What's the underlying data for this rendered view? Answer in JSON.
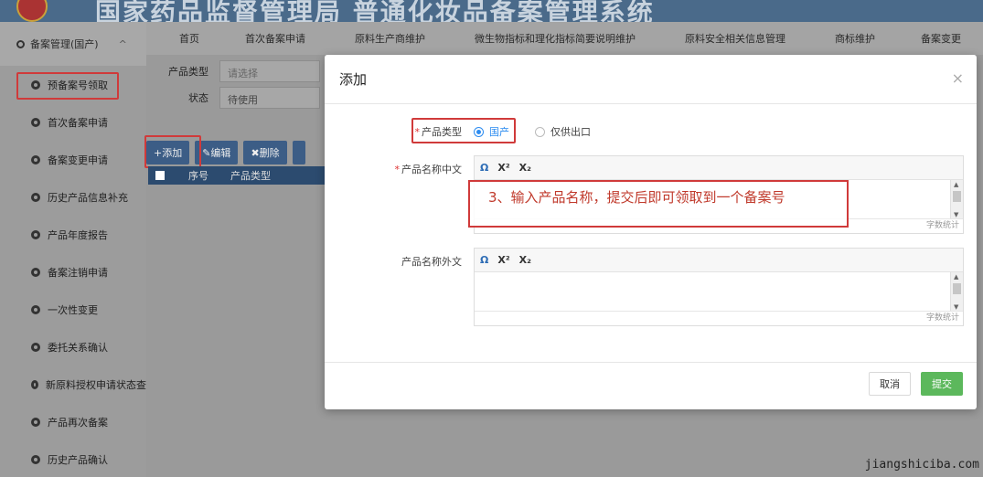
{
  "header": {
    "title": "国家药品监督管理局 普通化妆品备案管理系统"
  },
  "sidebar": {
    "group_label": "备案管理(国产)",
    "items": [
      {
        "label": "预备案号领取",
        "active": true
      },
      {
        "label": "首次备案申请"
      },
      {
        "label": "备案变更申请"
      },
      {
        "label": "历史产品信息补充"
      },
      {
        "label": "产品年度报告"
      },
      {
        "label": "备案注销申请"
      },
      {
        "label": "一次性变更"
      },
      {
        "label": "委托关系确认"
      },
      {
        "label": "新原料授权申请状态查"
      },
      {
        "label": "产品再次备案"
      },
      {
        "label": "历史产品确认"
      }
    ]
  },
  "topnav": [
    "首页",
    "首次备案申请",
    "原料生产商维护",
    "微生物指标和理化指标简要说明维护",
    "原料安全相关信息管理",
    "商标维护",
    "备案变更"
  ],
  "filters": {
    "product_type_label": "产品类型",
    "product_type_placeholder": "请选择",
    "status_label": "状态",
    "status_value": "待使用"
  },
  "toolbar": {
    "add": "+添加",
    "edit": "✎编辑",
    "delete": "✖删除"
  },
  "table": {
    "col_index": "序号",
    "col_type": "产品类型"
  },
  "modal": {
    "title": "添加",
    "product_type_label": "产品类型",
    "option_domestic": "国产",
    "option_export": "仅供出口",
    "name_cn_label": "产品名称中文",
    "name_foreign_label": "产品名称外文",
    "word_count": "字数统计",
    "annotation": "3、输入产品名称，提交后即可领取到一个备案号",
    "cancel": "取消",
    "submit": "提交"
  },
  "editor_toolbar": {
    "omega": "Ω",
    "sup": "X²",
    "sub": "X₂"
  },
  "watermark": "jiangshiciba.com"
}
